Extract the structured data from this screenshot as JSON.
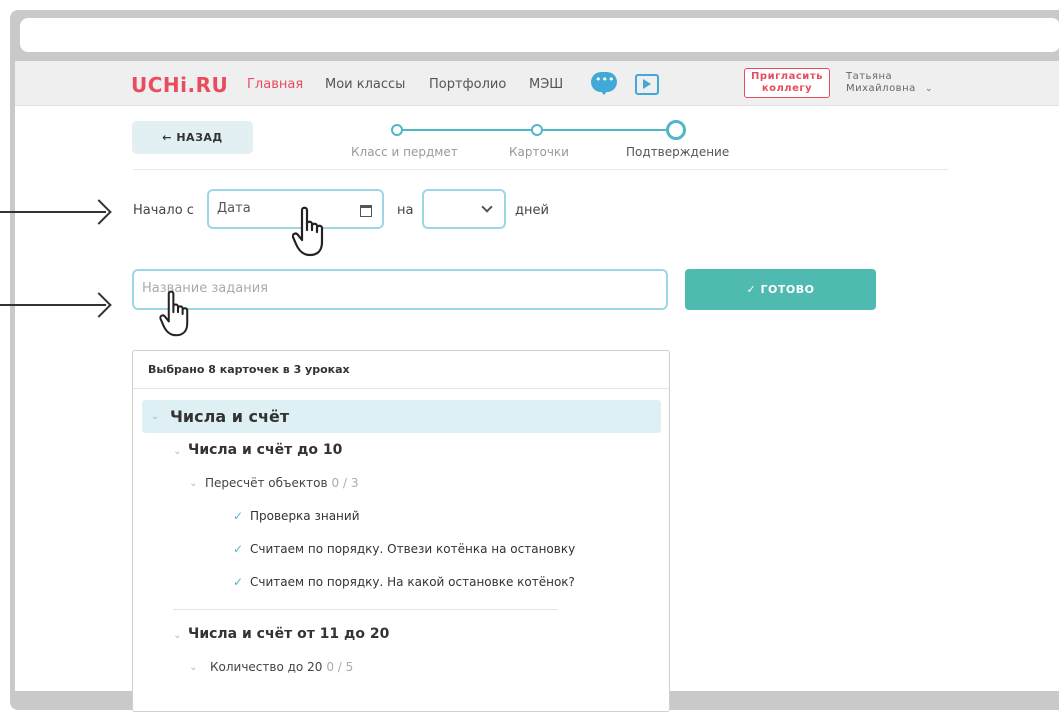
{
  "nav": {
    "logo": "UCHi.RU",
    "links": [
      "Главная",
      "Мои классы",
      "Портфолио",
      "МЭШ"
    ],
    "chat_icon": "chat-bubble-icon",
    "video_icon": "play-video-icon",
    "invite_line1": "Пригласить",
    "invite_line2": "коллегу",
    "user_first": "Татьяна",
    "user_last": "Михайловна"
  },
  "back_label": "← НАЗАД",
  "steps": [
    "Класс и пердмет",
    "Карточки",
    "Подтверждение"
  ],
  "form": {
    "start_label": "Начало с",
    "date_placeholder": "Дата",
    "on_label": "на",
    "days_label": "дней",
    "title_placeholder": "Название задания",
    "done_label": "✓ ГОТОВО"
  },
  "selection": {
    "summary": "Выбрано 8 карточек в 3 уроках",
    "topic": "Числа и счёт",
    "subtopics": [
      {
        "title": "Числа и счёт до 10",
        "lessons": [
          {
            "title": "Пересчёт объектов",
            "count": "0 / 3",
            "cards": [
              "Проверка знаний",
              "Считаем по порядку. Отвези котёнка на остановку",
              "Считаем по порядку. На какой остановке котёнок?"
            ]
          }
        ]
      },
      {
        "title": "Числа и счёт от 11 до 20",
        "lessons": [
          {
            "title": "Количество до 20",
            "count": "0 / 5",
            "cards": []
          }
        ]
      }
    ]
  },
  "colors": {
    "brand": "#e84c5f",
    "accent": "#4fb7c9",
    "button": "#4fbab0",
    "input_border": "#9fd6e6"
  }
}
